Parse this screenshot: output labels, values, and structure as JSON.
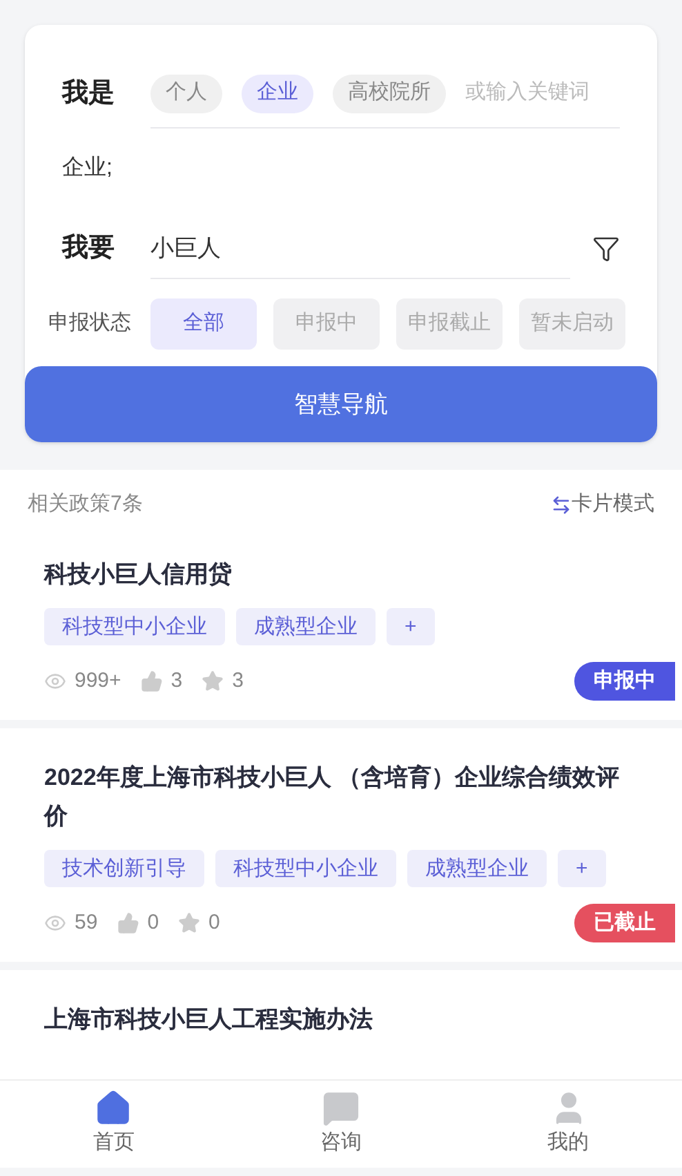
{
  "filter": {
    "identity": {
      "label": "我是",
      "chips": [
        {
          "label": "个人",
          "selected": false
        },
        {
          "label": "企业",
          "selected": true
        },
        {
          "label": "高校院所",
          "selected": false
        }
      ],
      "keyword": {
        "placeholder": "或输入关键词"
      },
      "chosen": "企业;"
    },
    "want": {
      "label": "我要",
      "value": "小巨人"
    },
    "status": {
      "label": "申报状态",
      "options": [
        {
          "label": "全部",
          "selected": true
        },
        {
          "label": "申报中",
          "selected": false
        },
        {
          "label": "申报截止",
          "selected": false
        },
        {
          "label": "暂未启动",
          "selected": false
        }
      ]
    },
    "button": "智慧导航"
  },
  "results": {
    "count": "相关政策7条",
    "mode": "卡片模式",
    "policies": [
      {
        "title": "科技小巨人信用贷",
        "tags": [
          "科技型中小企业",
          "成熟型企业",
          "+"
        ],
        "views": "999+",
        "likes": "3",
        "stars": "3",
        "badge": {
          "label": "申报中",
          "color": "#4f55e0"
        }
      },
      {
        "title": "2022年度上海市科技小巨人 （含培育）企业综合绩效评价",
        "tags": [
          "技术创新引导",
          "科技型中小企业",
          "成熟型企业",
          "+"
        ],
        "views": "59",
        "likes": "0",
        "stars": "0",
        "badge": {
          "label": "已截止",
          "color": "#e5505f"
        }
      },
      {
        "title": "上海市科技小巨人工程实施办法"
      }
    ]
  },
  "nav": [
    {
      "label": "首页",
      "kind": "home",
      "selected": true
    },
    {
      "label": "咨询",
      "kind": "chat",
      "selected": false
    },
    {
      "label": "我的",
      "kind": "user",
      "selected": false
    }
  ]
}
